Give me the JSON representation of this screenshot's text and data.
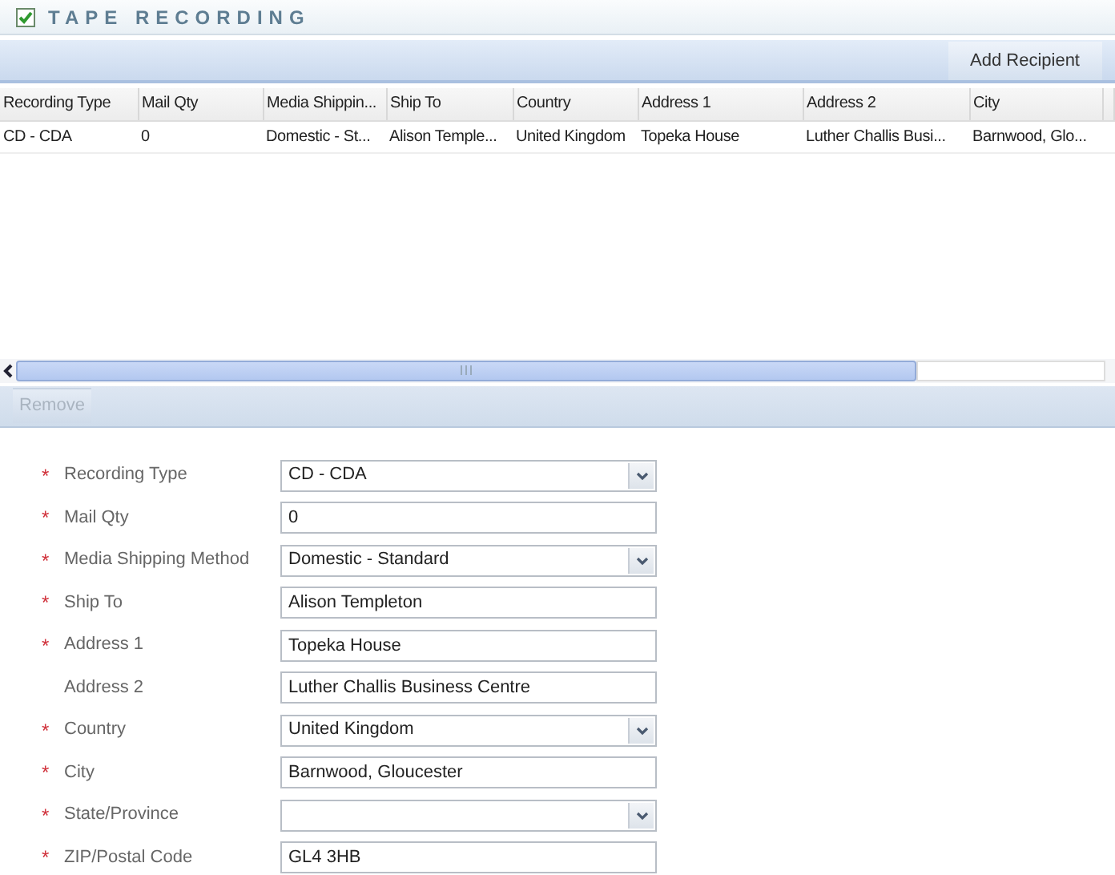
{
  "section": {
    "title": "TAPE RECORDING",
    "checked": true
  },
  "toolbar": {
    "button": "Add Recipient"
  },
  "table": {
    "columns": [
      "Recording Type",
      "Mail Qty",
      "Media Shippin...",
      "Ship To",
      "Country",
      "Address 1",
      "Address 2",
      "City"
    ],
    "rows": [
      [
        "CD - CDA",
        "0",
        "Domestic - St...",
        "Alison Temple...",
        "United Kingdom",
        "Topeka House",
        "Luther Challis Busi...",
        "Barnwood, Glo..."
      ]
    ]
  },
  "remove_button": {
    "label": "Remove",
    "disabled": true
  },
  "form": [
    {
      "required_mark": "*",
      "label": "Recording Type",
      "kind": "select",
      "value": "CD - CDA"
    },
    {
      "required_mark": "*",
      "label": "Mail Qty",
      "kind": "text",
      "value": "0"
    },
    {
      "required_mark": "*",
      "label": "Media Shipping Method",
      "kind": "select",
      "value": "Domestic - Standard"
    },
    {
      "required_mark": "*",
      "label": "Ship To",
      "kind": "text",
      "value": "Alison Templeton"
    },
    {
      "required_mark": "*",
      "label": "Address 1",
      "kind": "text",
      "value": "Topeka House"
    },
    {
      "label": "Address 2",
      "kind": "text",
      "value": "Luther Challis Business Centre"
    },
    {
      "required_mark": "*",
      "label": "Country",
      "kind": "select",
      "value": "United Kingdom"
    },
    {
      "required_mark": "*",
      "label": "City",
      "kind": "text",
      "value": "Barnwood, Gloucester"
    },
    {
      "required_mark": "*",
      "label": "State/Province",
      "kind": "select"
    },
    {
      "required_mark": "*",
      "label": "ZIP/Postal Code",
      "kind": "text",
      "value": "GL4 3HB"
    }
  ]
}
